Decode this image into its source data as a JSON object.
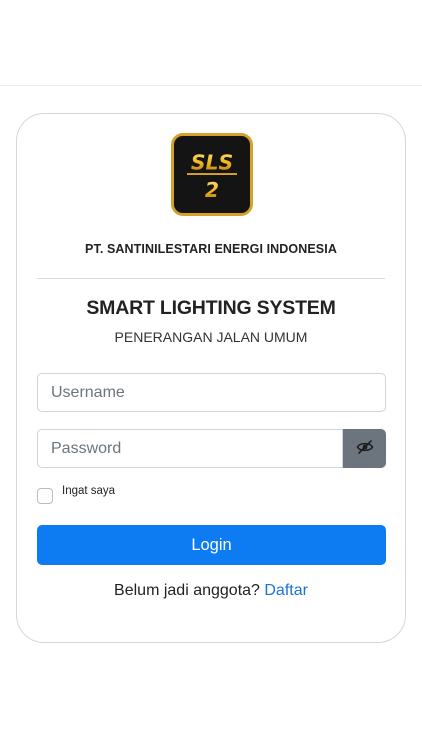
{
  "logo": {
    "text_top": "SLS",
    "text_bottom": "2",
    "tagline": "SMART LIGHTING SYSTEM"
  },
  "company": "PT. SANTINILESTARI ENERGI INDONESIA",
  "title": "SMART LIGHTING SYSTEM",
  "subtitle": "PENERANGAN JALAN UMUM",
  "form": {
    "username_placeholder": "Username",
    "password_placeholder": "Password",
    "remember_label": "Ingat saya",
    "login_label": "Login"
  },
  "register": {
    "prompt": "Belum jadi anggota?",
    "link_label": "Daftar"
  },
  "colors": {
    "primary": "#0d7bf2",
    "secondary": "#6c757d",
    "link": "#1a73d9",
    "logo_gold": "#d4a12a"
  },
  "icons": {
    "password_toggle": "eye-slash-icon"
  }
}
